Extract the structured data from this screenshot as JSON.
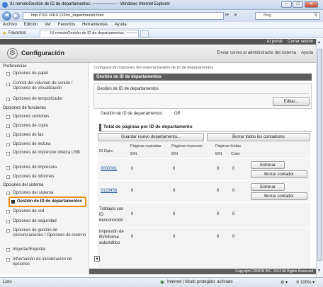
{
  "browser": {
    "title": "IU remotoGestión de ID de departamentos: ──────── - Windows Internet Explorer",
    "url": "http://192.168.0.215/rn_departmentid.html",
    "search_placeholder": "Bing",
    "menu": [
      "Archivo",
      "Edición",
      "Ver",
      "Favoritos",
      "Herramientas",
      "Ayuda"
    ],
    "favorites_label": "Favoritos",
    "tab_label": "IU remotoGestión de ID de departamentos: ────",
    "status_left": "Listo",
    "status_zone": "Internet | Modo protegido: activado",
    "zoom": "100%"
  },
  "header": {
    "portal_link": "Al portal",
    "logout_link": "Cerrar sesión",
    "title": "Configuración",
    "mail_link": "Enviar correo al administrador del sistema",
    "help_link": "Ayuda"
  },
  "sidebar": {
    "sections": [
      {
        "title": "Preferencias",
        "items": [
          "Opciones de papel",
          "Control del volumen de sonido / Opciones de visualización",
          "Opciones de temporizador"
        ]
      },
      {
        "title": "Opciones de funciones",
        "items": [
          "Opciones comunes",
          "Opciones de copia",
          "Opciones de fax",
          "Opciones de lectura",
          "Opciones de impresión directa USB",
          "Opciones de impresora",
          "Opciones de informes"
        ]
      },
      {
        "title": "Opciones del sistema",
        "items": [
          "Opciones del sistema",
          "Gestión de ID de departamentos",
          "Opciones de red",
          "Opciones de seguridad",
          "Opciones de gestión de comunicaciones / Opciones de reenvío",
          "Importar/Exportar",
          "Información de inicialización de opciones"
        ]
      }
    ]
  },
  "main": {
    "breadcrumb": "Configuración:Opciones del sistema:Gestión de ID de departamentos",
    "page_title": "Gestión de ID de departamentos",
    "box_title": "Gestión de ID de departamentos",
    "edit_label": "Editar...",
    "status_label": "Gestión de ID de departamentos:",
    "status_value": "Off",
    "totals_title": "Total de páginas por ID de departamento",
    "register_label": "Guardar nuevo departamento...",
    "clear_all_label": "Borrar todos los contadores",
    "columns": {
      "id": "ID Dpto.",
      "copied": "Páginas copiadas",
      "printed": "Páginas impresas",
      "scanned": "Páginas leídas",
      "bw": "B/N",
      "color": "Color"
    },
    "rows": [
      {
        "id": "0000001",
        "copied": "0",
        "printed": "0",
        "scan_bw": "0",
        "scan_color": "0"
      },
      {
        "id": "0123456",
        "copied": "0",
        "printed": "0",
        "scan_bw": "0",
        "scan_color": "0"
      },
      {
        "id": "Trabajos con ID desconocido",
        "copied": "0",
        "printed": "0",
        "scan_bw": "0",
        "scan_color": "0"
      },
      {
        "id": "Impresión de RI/Informe automático",
        "copied": "0",
        "printed": "0",
        "scan_bw": "0",
        "scan_color": "0"
      }
    ],
    "delete_label": "Eliminar",
    "clear_label": "Borrar contador",
    "copyright": "Copyright CANON INC. 2013 All Rights Reserved"
  }
}
